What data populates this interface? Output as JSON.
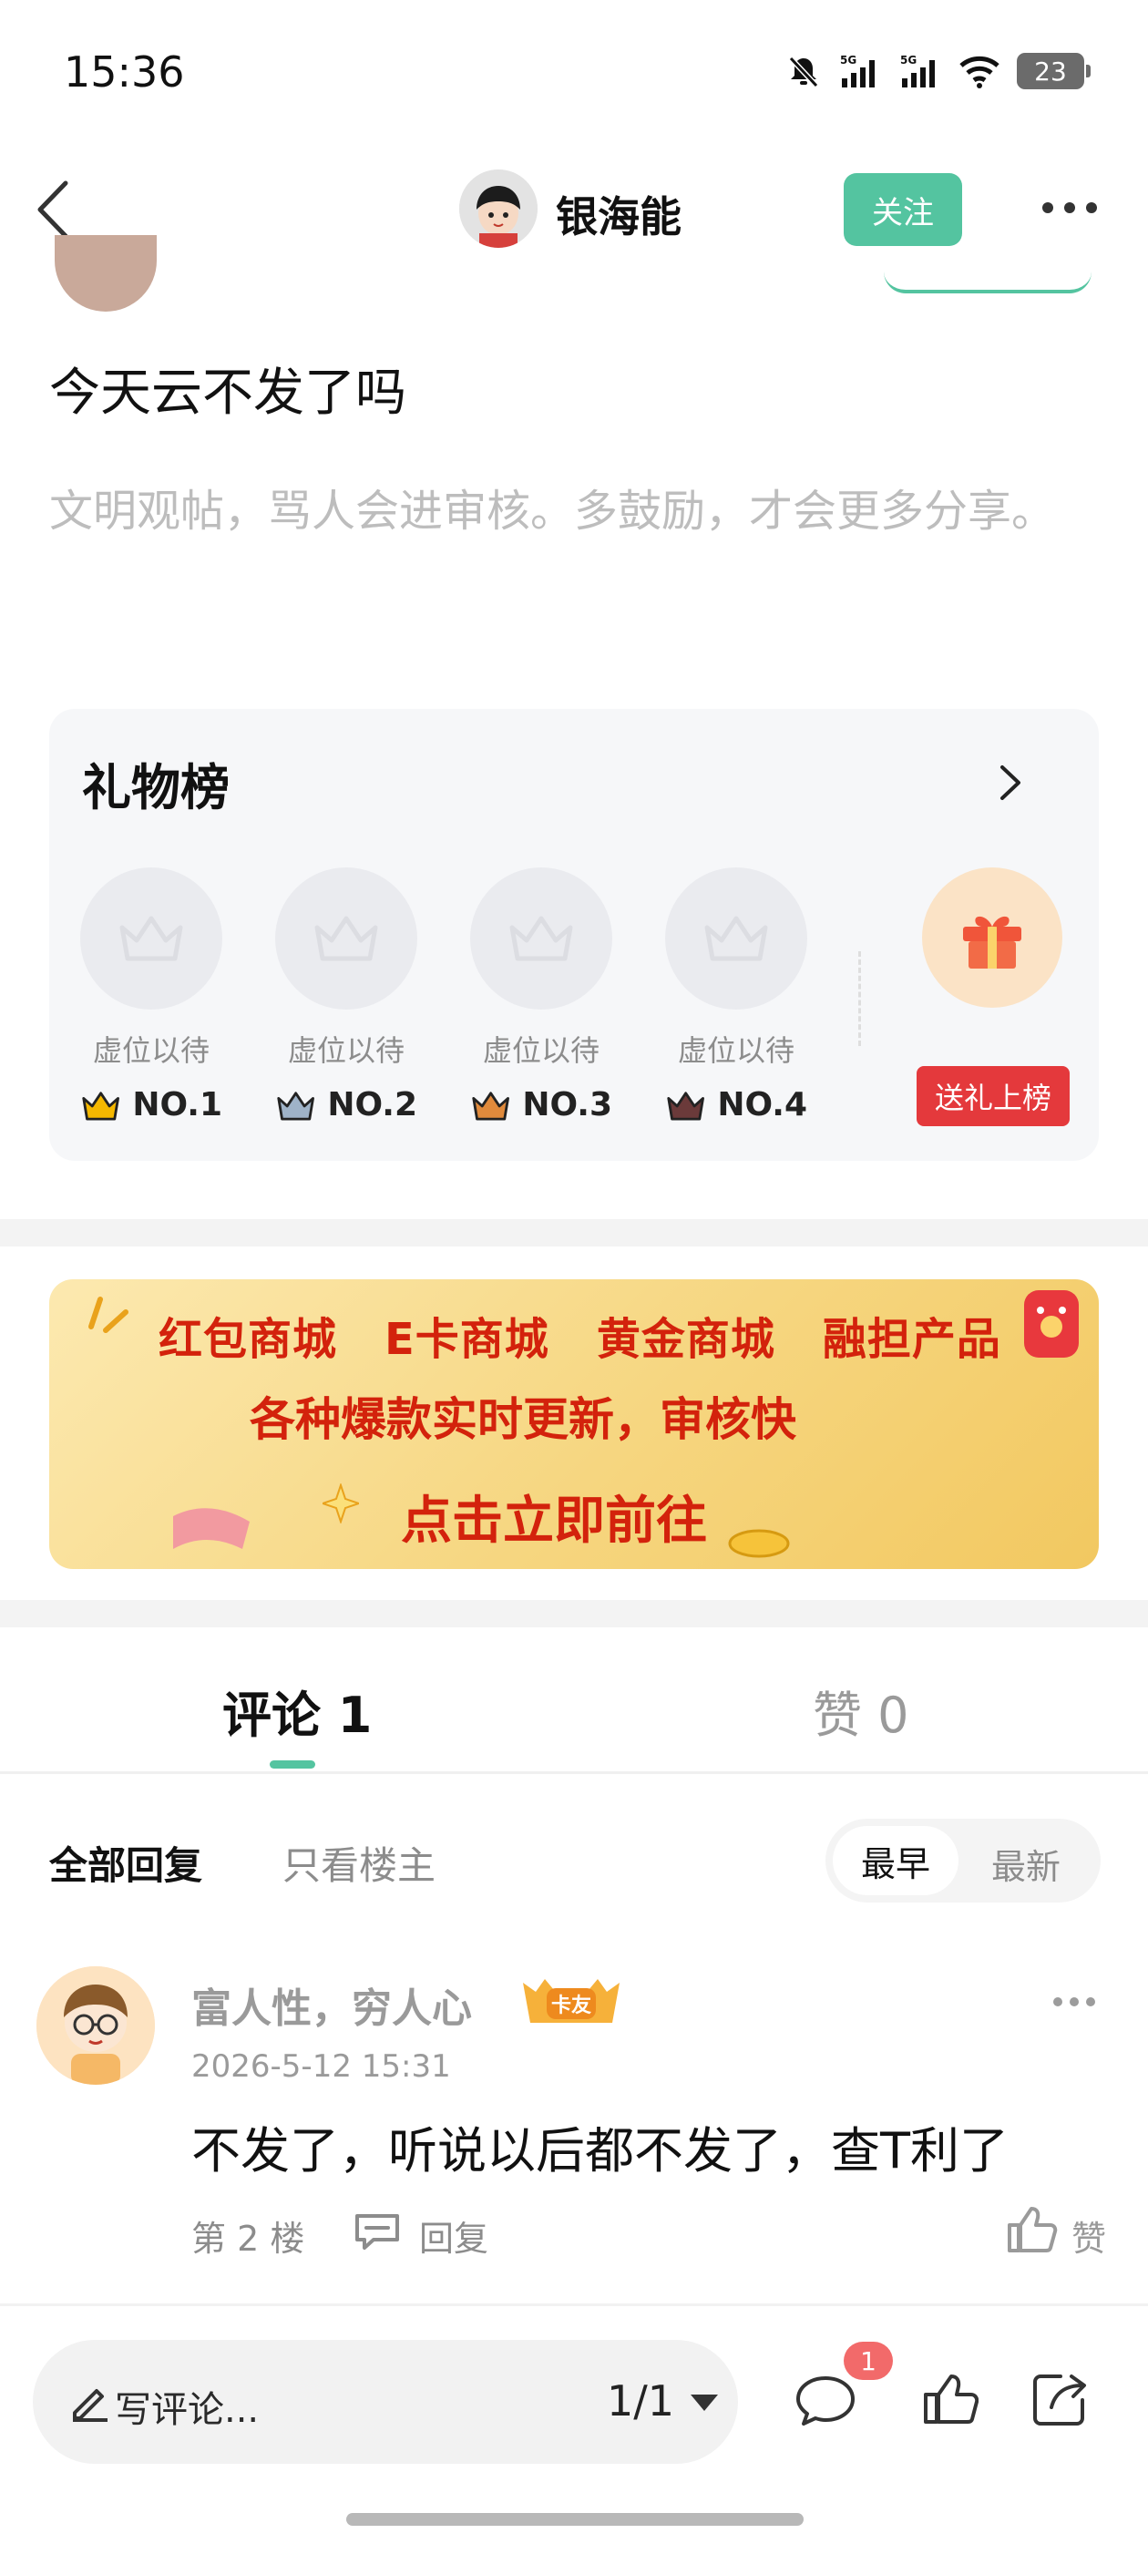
{
  "status_bar": {
    "time": "15:36",
    "battery": "23",
    "net1": "5G",
    "net2": "5G"
  },
  "header": {
    "author_name": "银海能",
    "follow_label": "关注"
  },
  "post": {
    "title": "今天云不发了吗",
    "hint": "文明观帖，骂人会进审核。多鼓励，才会更多分享。"
  },
  "gift_board": {
    "title": "礼物榜",
    "slots": [
      {
        "label": "虚位以待",
        "rank": "NO.1",
        "crown_color": "#f5b800"
      },
      {
        "label": "虚位以待",
        "rank": "NO.2",
        "crown_color": "#9fb3c8"
      },
      {
        "label": "虚位以待",
        "rank": "NO.3",
        "crown_color": "#e08a3c"
      },
      {
        "label": "虚位以待",
        "rank": "NO.4",
        "crown_color": "#6b3a3a"
      }
    ],
    "send_label": "送礼上榜"
  },
  "banner": {
    "categories": [
      "红包商城",
      "E卡商城",
      "黄金商城",
      "融担产品"
    ],
    "line2": "各种爆款实时更新，审核快",
    "line3": "点击立即前往"
  },
  "tabs": {
    "comments": "评论 1",
    "likes": "赞 0"
  },
  "filters": {
    "all": "全部回复",
    "op_only": "只看楼主",
    "earliest": "最早",
    "newest": "最新"
  },
  "comment": {
    "name": "富人性，穷人心",
    "badge": "卡友",
    "time": "2026-5-12 15:31",
    "text": "不发了，听说以后都不发了，查T利了",
    "floor": "第 2 楼",
    "reply": "回复",
    "like": "赞"
  },
  "bottom_bar": {
    "compose_placeholder": "写评论...",
    "pager": "1/1",
    "comment_badge": "1"
  },
  "colors": {
    "accent": "#54c4a0",
    "red": "#e4393c",
    "banner_text": "#d3220c"
  }
}
